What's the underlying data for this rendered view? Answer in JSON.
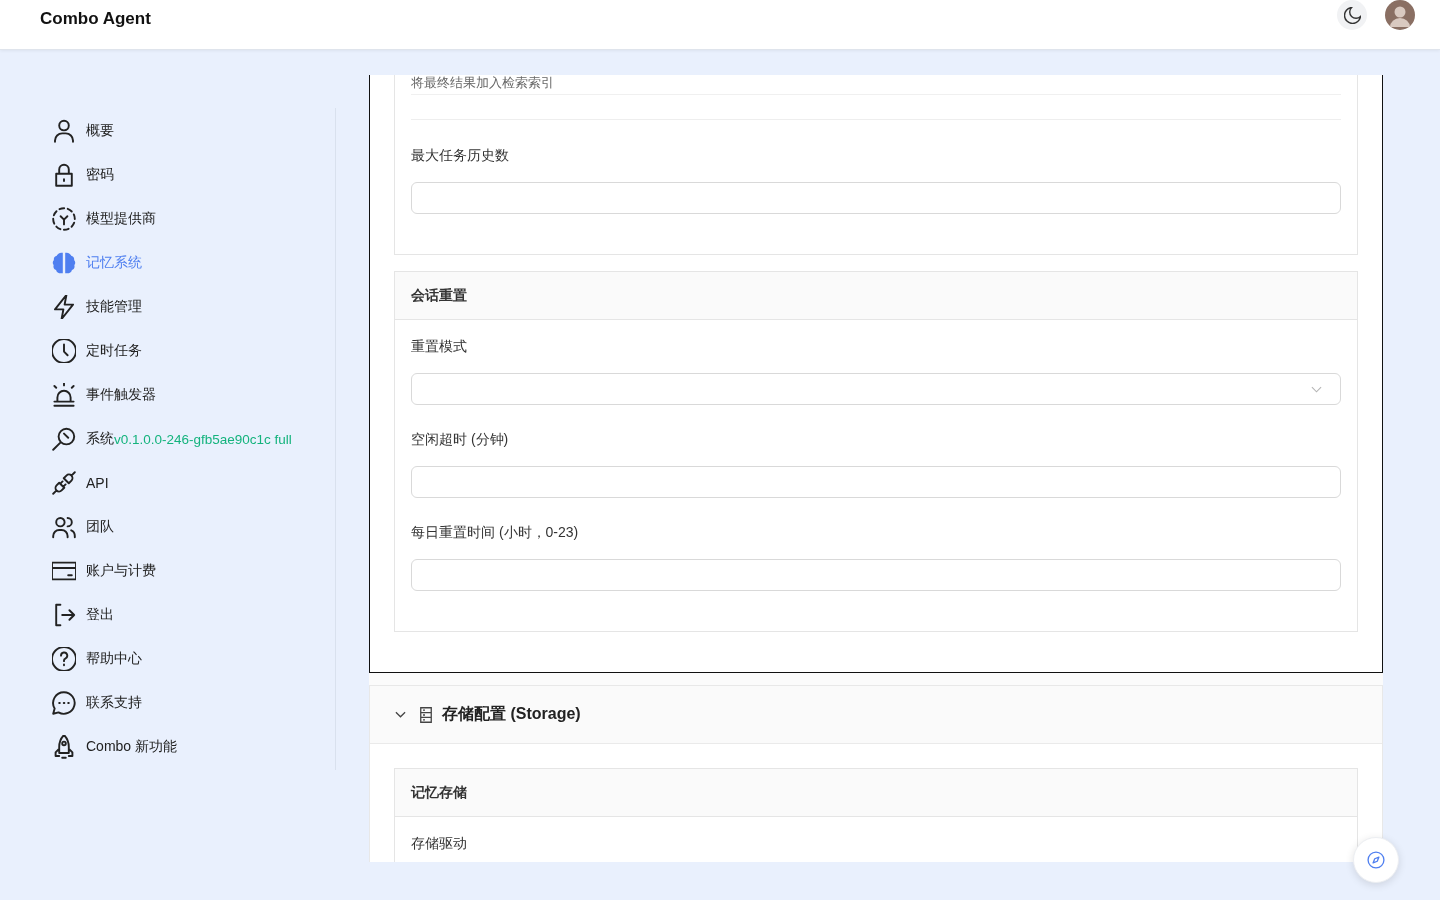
{
  "header": {
    "title": "Combo Agent"
  },
  "sidebar": {
    "items": [
      {
        "label": "概要",
        "selected": false
      },
      {
        "label": "密码",
        "selected": false
      },
      {
        "label": "模型提供商",
        "selected": false
      },
      {
        "label": "记忆系统",
        "selected": true
      },
      {
        "label": "技能管理",
        "selected": false
      },
      {
        "label": "定时任务",
        "selected": false
      },
      {
        "label": "事件触发器",
        "selected": false
      },
      {
        "label": "系统",
        "version": "v0.1.0.0-246-gfb5ae90c1c full",
        "selected": false
      },
      {
        "label": "API",
        "selected": false
      },
      {
        "label": "团队",
        "selected": false
      },
      {
        "label": "账户与计费",
        "selected": false
      },
      {
        "label": "登出",
        "selected": false
      },
      {
        "label": "帮助中心",
        "selected": false
      },
      {
        "label": "联系支持",
        "selected": false
      },
      {
        "label": "Combo 新功能",
        "selected": false
      }
    ]
  },
  "main": {
    "panel": {
      "groups": [
        {
          "description": "将最终结果加入检索索引",
          "fields": [
            {
              "label": "最大任务历史数",
              "kind": "input"
            }
          ]
        },
        {
          "title": "会话重置",
          "fields": [
            {
              "label": "重置模式",
              "kind": "select"
            },
            {
              "label": "空闲超时 (分钟)",
              "kind": "input"
            },
            {
              "label": "每日重置时间 (小时，0-23)",
              "kind": "input"
            }
          ]
        }
      ]
    },
    "sections": [
      {
        "title": "存储配置 (Storage)",
        "expanded": true,
        "groups": [
          {
            "title": "记忆存储",
            "fields": [
              {
                "label": "存储驱动"
              }
            ]
          }
        ]
      }
    ]
  }
}
